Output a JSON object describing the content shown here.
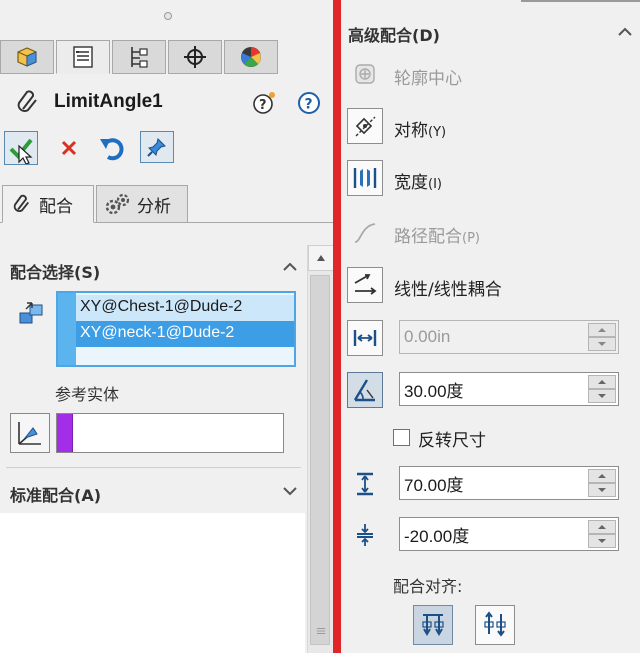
{
  "feature": {
    "title": "LimitAngle1"
  },
  "subtabs": {
    "mates": "配合",
    "analysis": "分析"
  },
  "mate_selection": {
    "header": "配合选择(S)",
    "items": [
      "XY@Chest-1@Dude-2",
      "XY@neck-1@Dude-2"
    ],
    "reference_label": "参考实体",
    "reference_color": "#a42ee8"
  },
  "standard_mates": {
    "header": "标准配合(A)"
  },
  "advanced": {
    "header": "高级配合(D)",
    "profile_center": "轮廓中心",
    "symmetric": "对称",
    "symmetric_key": "(Y)",
    "width": "宽度",
    "width_key": "(I)",
    "path_mate": "路径配合",
    "path_mate_key": "(P)",
    "linear_coupler": "线性/线性耦合",
    "distance_value": "0.00in",
    "angle_value": "30.00度",
    "flip_dimension": "反转尺寸",
    "max_value": "70.00度",
    "min_value": "-20.00度",
    "alignment_label": "配合对齐:"
  },
  "colors": {
    "accent_red": "#e0242a",
    "selection_blue": "#3d9ee6"
  }
}
